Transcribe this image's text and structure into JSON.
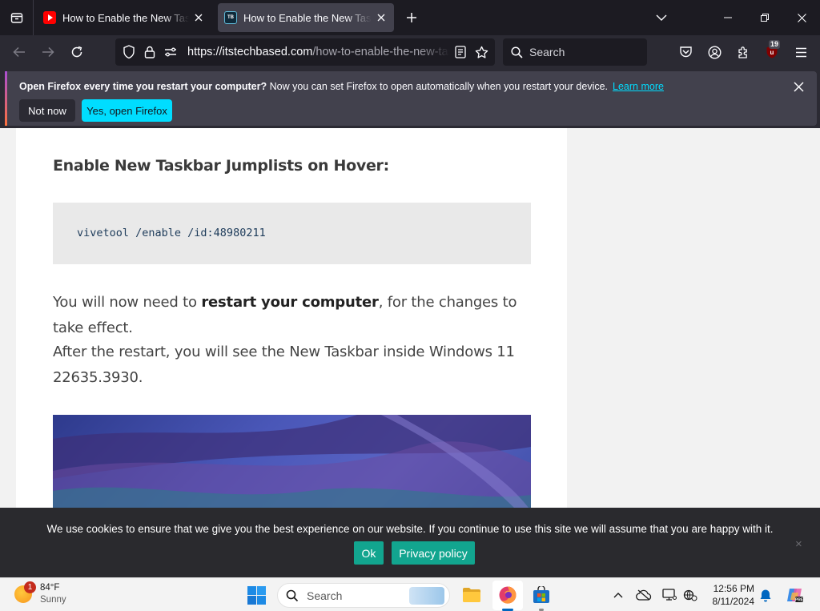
{
  "browser": {
    "tabs": [
      {
        "title": "How to Enable the New Taskbar Jumplists",
        "favicon": "youtube-icon",
        "active": false
      },
      {
        "title": "How to Enable the New Taskbar Jumplists",
        "favicon": "itstechbased-icon",
        "active": true
      }
    ],
    "url": {
      "domain": "https://itstechbased.com",
      "path": "/how-to-enable-the-new-taskbar"
    },
    "search_placeholder": "Search",
    "extension_badge": "19"
  },
  "notification": {
    "bold_text": "Open Firefox every time you restart your computer?",
    "text": " Now you can set Firefox to open automatically when you restart your device.",
    "link": "Learn more",
    "not_now": "Not now",
    "yes_button": "Yes, open Firefox"
  },
  "article": {
    "heading": "Enable New Taskbar Jumplists on Hover:",
    "code": "vivetool /enable /id:48980211",
    "p1_before": "You will now need to ",
    "p1_bold": "restart your computer",
    "p1_after": ", for the changes to take effect.",
    "p2": "After the restart, you will see the New Taskbar inside Windows 11 22635.3930."
  },
  "cookie": {
    "text": "We use cookies to ensure that we give you the best experience on our website. If you continue to use this site we will assume that you are happy with it.",
    "ok": "Ok",
    "privacy": "Privacy policy",
    "close": "×"
  },
  "taskbar": {
    "weather_temp": "84°F",
    "weather_cond": "Sunny",
    "weather_badge": "1",
    "search_label": "Search",
    "time": "12:56 PM",
    "date": "8/11/2024"
  },
  "colors": {
    "accent": "#00ddff",
    "cookie_button": "#12a58f",
    "browser_frame": "#1c1b22"
  }
}
